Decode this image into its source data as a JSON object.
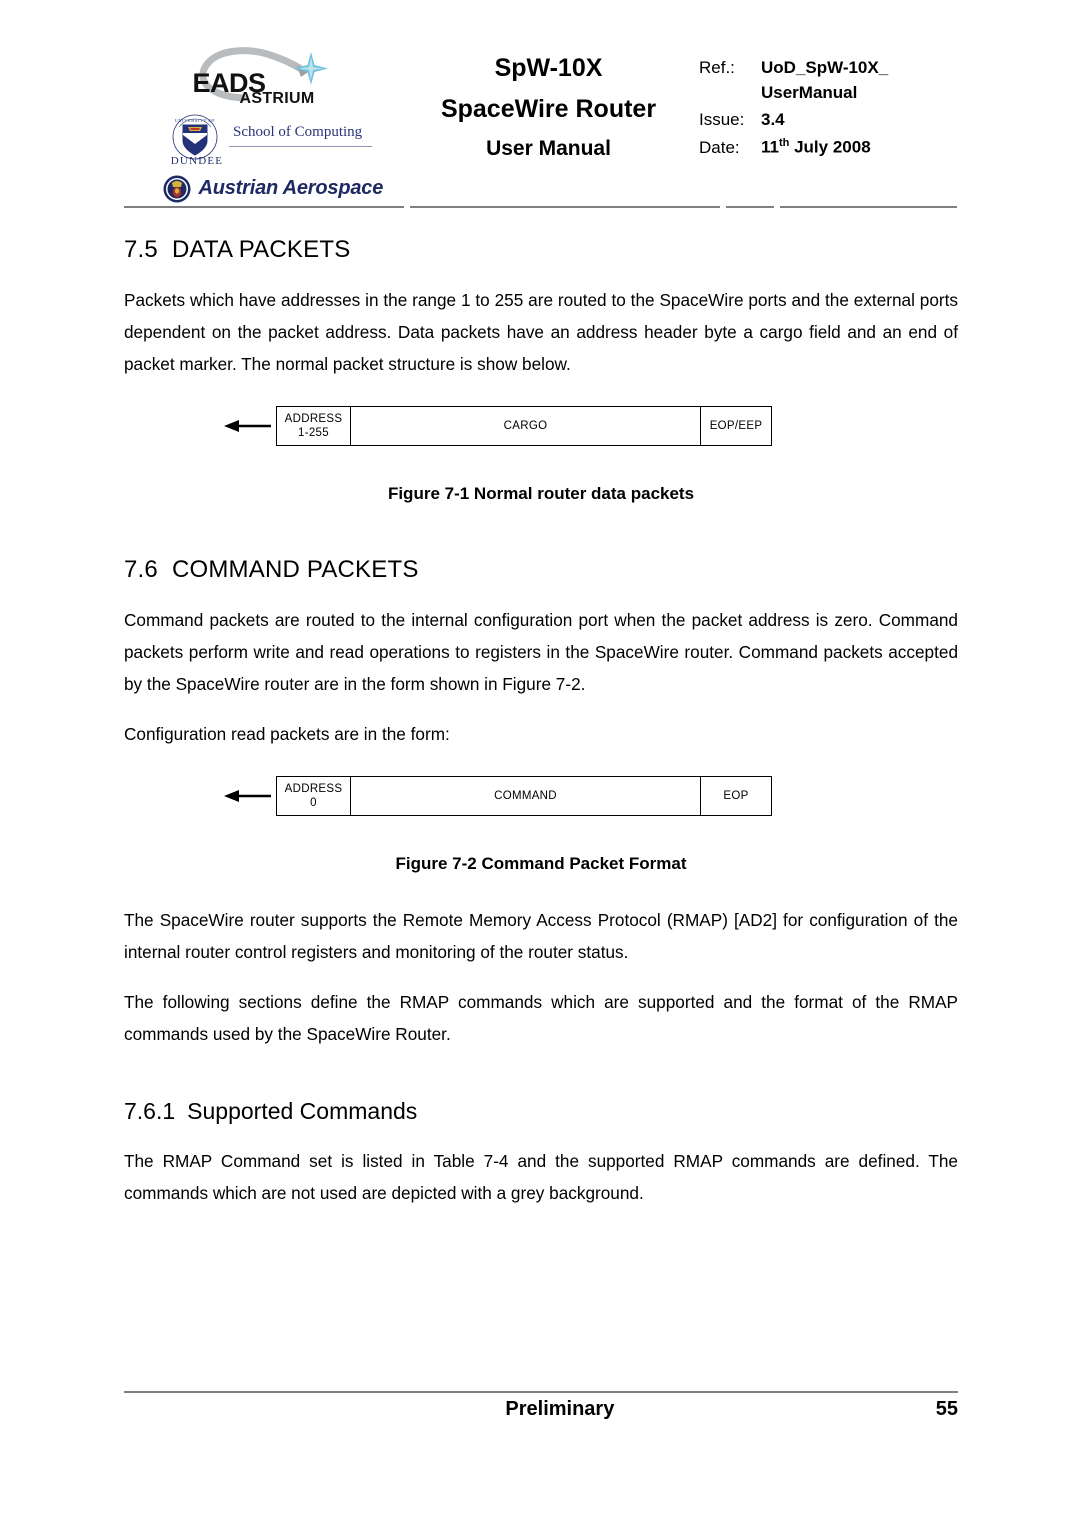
{
  "header": {
    "logos": {
      "eads": {
        "name": "EADS",
        "sub": "ASTRIUM"
      },
      "dundee": {
        "university": "UNIVERSITY OF",
        "city": "DUNDEE",
        "school": "School of Computing"
      },
      "austrian": {
        "name": "Austrian Aerospace"
      }
    },
    "title": {
      "line1": "SpW-10X",
      "line2": "SpaceWire Router",
      "line3": "User Manual"
    },
    "meta": {
      "ref_label": "Ref.:",
      "ref_value": "UoD_SpW-10X_",
      "ref_value_cont": "UserManual",
      "issue_label": "Issue:",
      "issue_value": "3.4",
      "date_label": "Date:",
      "date_day": "11",
      "date_sup": "th",
      "date_rest": " July 2008"
    }
  },
  "sections": {
    "data_packets": {
      "number": "7.5",
      "title": "DATA PACKETS",
      "paragraph": "Packets which have addresses in the range 1 to 255 are routed to the SpaceWire ports and the external ports dependent on the packet address.  Data packets have an address header byte a cargo field and an end of packet marker.  The normal packet structure is show below."
    },
    "command_packets": {
      "number": "7.6",
      "title": "COMMAND PACKETS",
      "paragraph1": "Command packets are routed to the internal configuration port when the packet address is zero. Command packets perform write and read operations to registers in the SpaceWire router. Command packets accepted by the SpaceWire router are in the form shown in Figure 7-2.",
      "paragraph2": "Configuration read packets are in the form:",
      "paragraph3": "The SpaceWire router supports the Remote Memory Access Protocol (RMAP) [AD2] for configuration of the internal router control registers and monitoring of the router status.",
      "paragraph4": "The following sections define the RMAP commands which are supported and the format of the RMAP commands used by the SpaceWire Router."
    },
    "supported_commands": {
      "number": "7.6.1",
      "title": "Supported Commands",
      "paragraph": "The RMAP Command set is listed in Table 7-4 and the supported RMAP commands are defined. The commands which are not used are depicted with a grey background."
    }
  },
  "figures": {
    "fig71": {
      "caption": "Figure 7-1 Normal router data packets",
      "cells": {
        "address_label": "ADDRESS",
        "address_range": "1-255",
        "payload": "CARGO",
        "terminator": "EOP/EEP"
      }
    },
    "fig72": {
      "caption": "Figure 7-2 Command Packet Format",
      "cells": {
        "address_label": "ADDRESS",
        "address_range": "0",
        "payload": "COMMAND",
        "terminator": "EOP"
      }
    }
  },
  "footer": {
    "status": "Preliminary",
    "page_number": "55"
  },
  "colors": {
    "rule": "#808080",
    "dundee_blue": "#2a3578",
    "austrian_blue": "#1d2a63",
    "astrium_star": "#6fc3dd"
  }
}
